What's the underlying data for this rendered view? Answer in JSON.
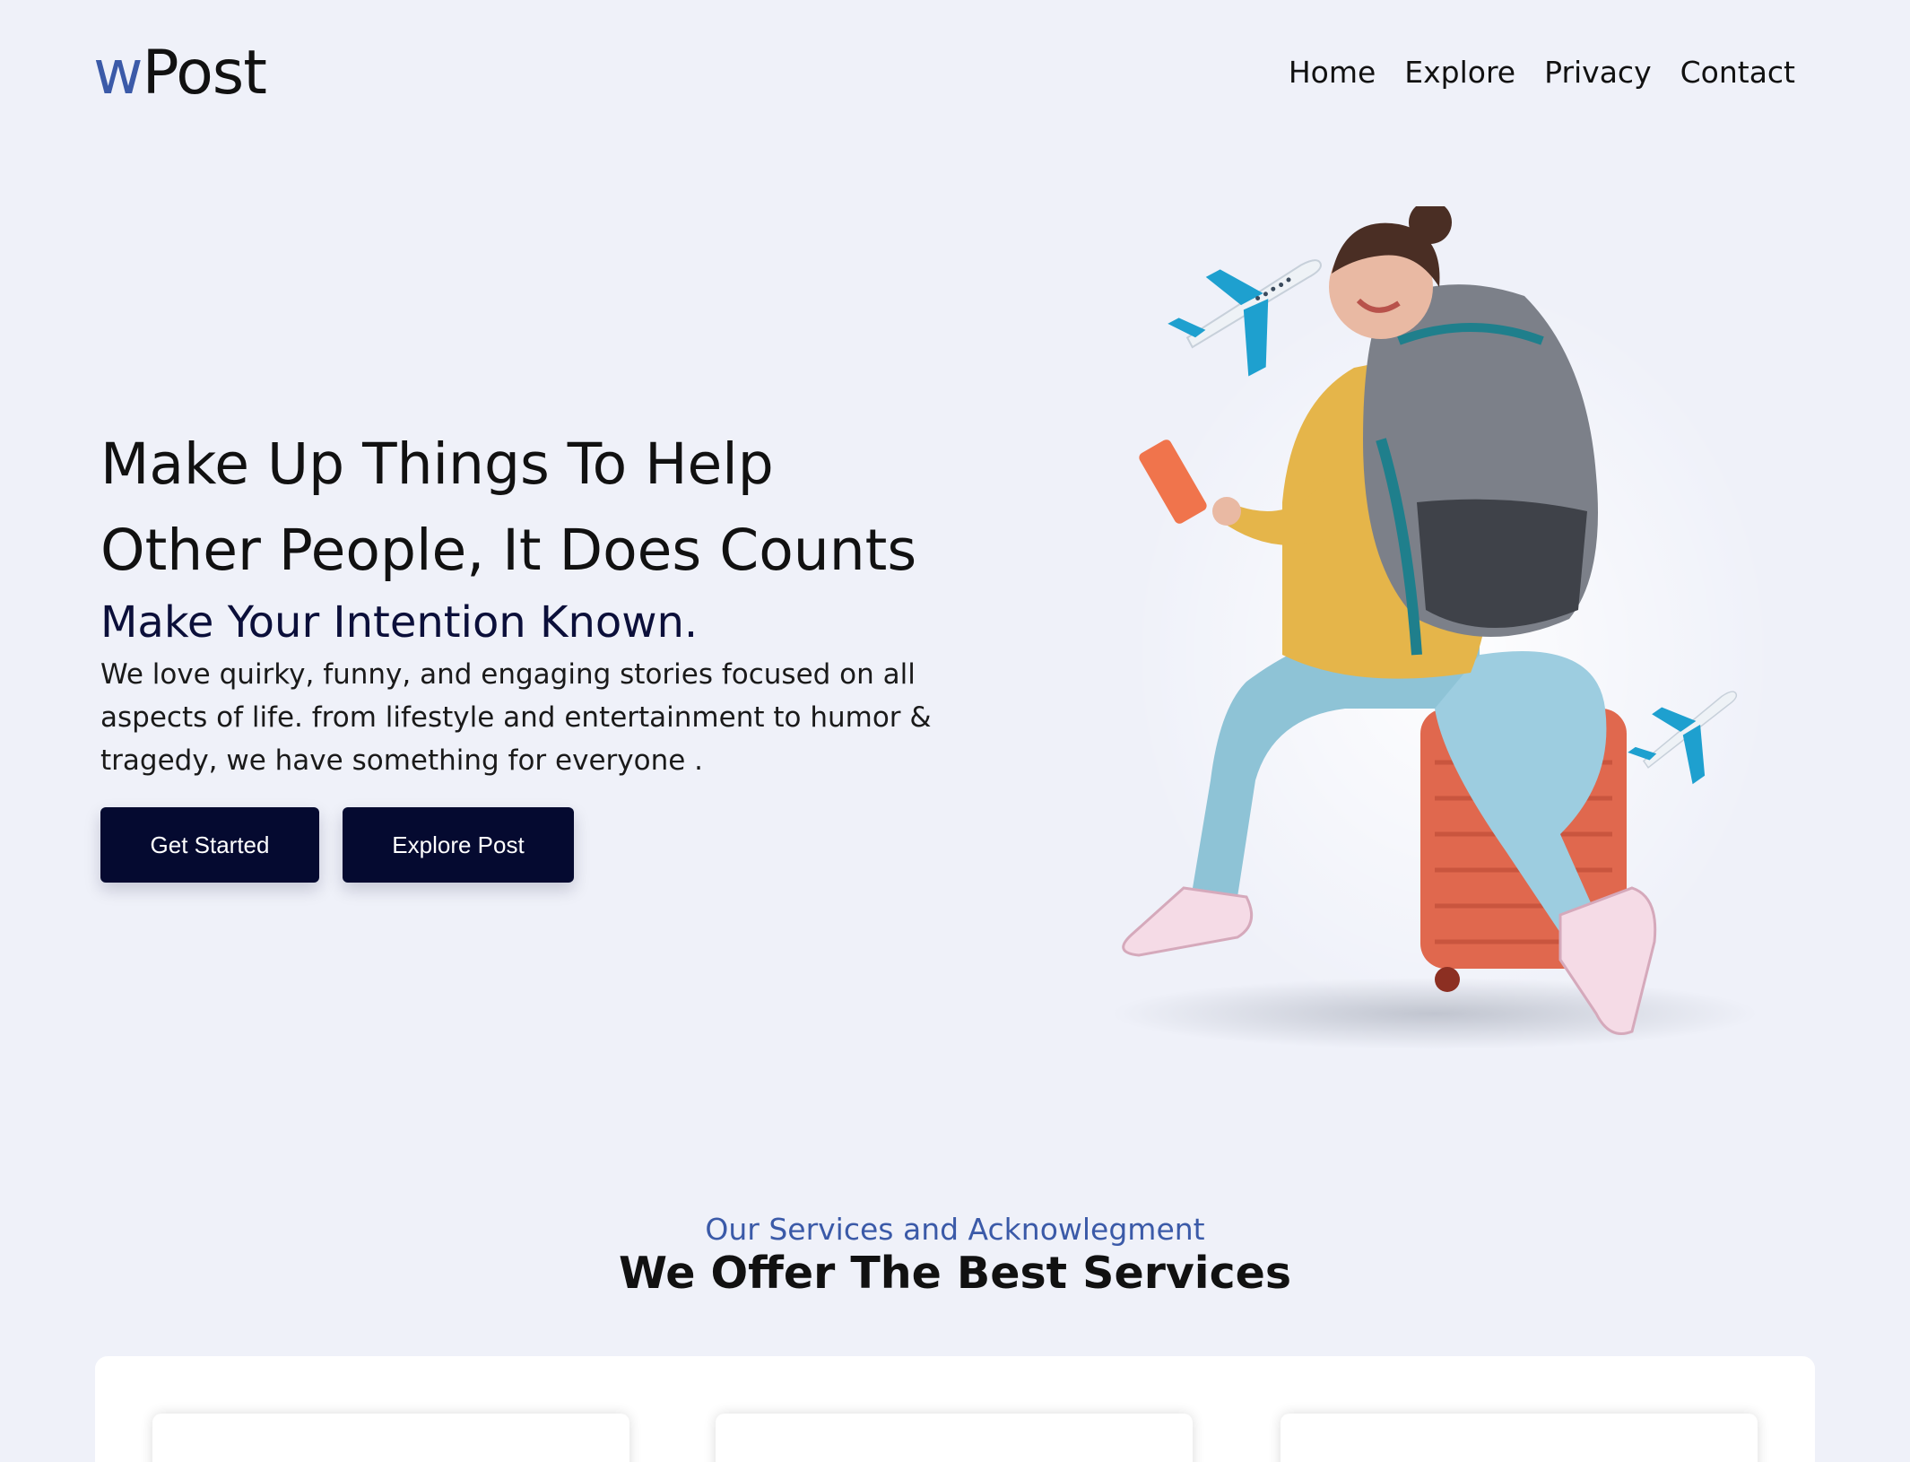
{
  "header": {
    "logo_prefix": "w",
    "logo_suffix": "Post",
    "nav": [
      "Home",
      "Explore",
      "Privacy",
      "Contact"
    ]
  },
  "hero": {
    "title_line1": "Make Up Things To Help",
    "title_line2": "Other People, It Does Counts",
    "subtitle": "Make Your Intention Known.",
    "description": "We love quirky, funny, and engaging stories focused on all aspects of life. from lifestyle and entertainment to humor & tragedy, we have something for everyone .",
    "primary_button": "Get Started",
    "secondary_button": "Explore Post"
  },
  "services": {
    "eyebrow": "Our Services and Acknowlegment",
    "title": "We Offer The Best Services"
  },
  "colors": {
    "background": "#eff1f9",
    "brand_blue": "#3b5aa8",
    "button_navy": "#050a30"
  }
}
